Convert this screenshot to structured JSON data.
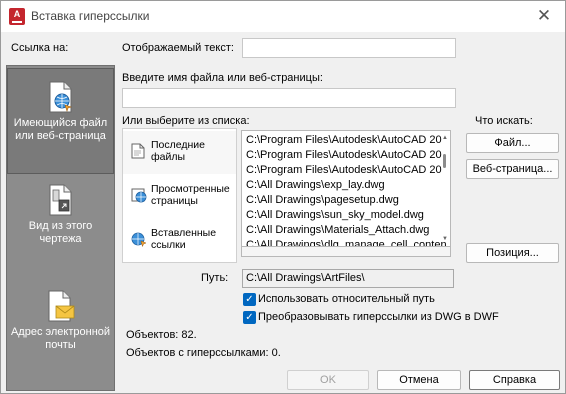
{
  "window": {
    "title": "Вставка гиперссылки",
    "app_icon_letter": "A",
    "close_glyph": "✕"
  },
  "link_to": {
    "label": "Ссылка на:",
    "items": [
      {
        "label": "Имеющийся файл или веб-страница",
        "icon": "globe-document-icon",
        "active": true
      },
      {
        "label": "Вид из этого чертежа",
        "icon": "drawing-view-icon",
        "active": false
      },
      {
        "label": "Адрес электронной почты",
        "icon": "email-icon",
        "active": false
      }
    ]
  },
  "display_text": {
    "label": "Отображаемый текст:",
    "value": ""
  },
  "filename": {
    "label": "Введите имя файла или веб-страницы:",
    "value": ""
  },
  "choose_from_list": {
    "label": "Или выберите из списка:",
    "sources": [
      {
        "label": "Последние файлы",
        "icon": "recent-files-icon",
        "active": true
      },
      {
        "label": "Просмотренные страницы",
        "icon": "browsed-pages-icon",
        "active": false
      },
      {
        "label": "Вставленные ссылки",
        "icon": "inserted-links-icon",
        "active": false
      }
    ],
    "files": [
      "C:\\Program Files\\Autodesk\\AutoCAD 20",
      "C:\\Program Files\\Autodesk\\AutoCAD 20",
      "C:\\Program Files\\Autodesk\\AutoCAD 20",
      "C:\\All Drawings\\exp_lay.dwg",
      "C:\\All Drawings\\pagesetup.dwg",
      "C:\\All Drawings\\sun_sky_model.dwg",
      "C:\\All Drawings\\Materials_Attach.dwg",
      "C:\\All Drawings\\dlg_manage_cell_conten"
    ]
  },
  "search": {
    "label": "Что искать:",
    "file_button": "Файл...",
    "web_button": "Веб-страница...",
    "position_button": "Позиция..."
  },
  "path": {
    "label": "Путь:",
    "value": "C:\\All Drawings\\ArtFiles\\"
  },
  "options": {
    "relative_path": {
      "label": "Использовать относительный путь",
      "checked": true
    },
    "convert_dwg": {
      "label": "Преобразовывать гиперссылки из DWG в DWF",
      "checked": true
    }
  },
  "stats": {
    "objects": "Объектов: 82.",
    "objects_with_links": "Объектов с гиперссылками: 0."
  },
  "footer": {
    "ok": "OK",
    "cancel": "Отмена",
    "help": "Справка"
  },
  "colors": {
    "checkbox": "#0067c0",
    "left_pane": "#8c8c8c",
    "brand": "#c4262e"
  }
}
